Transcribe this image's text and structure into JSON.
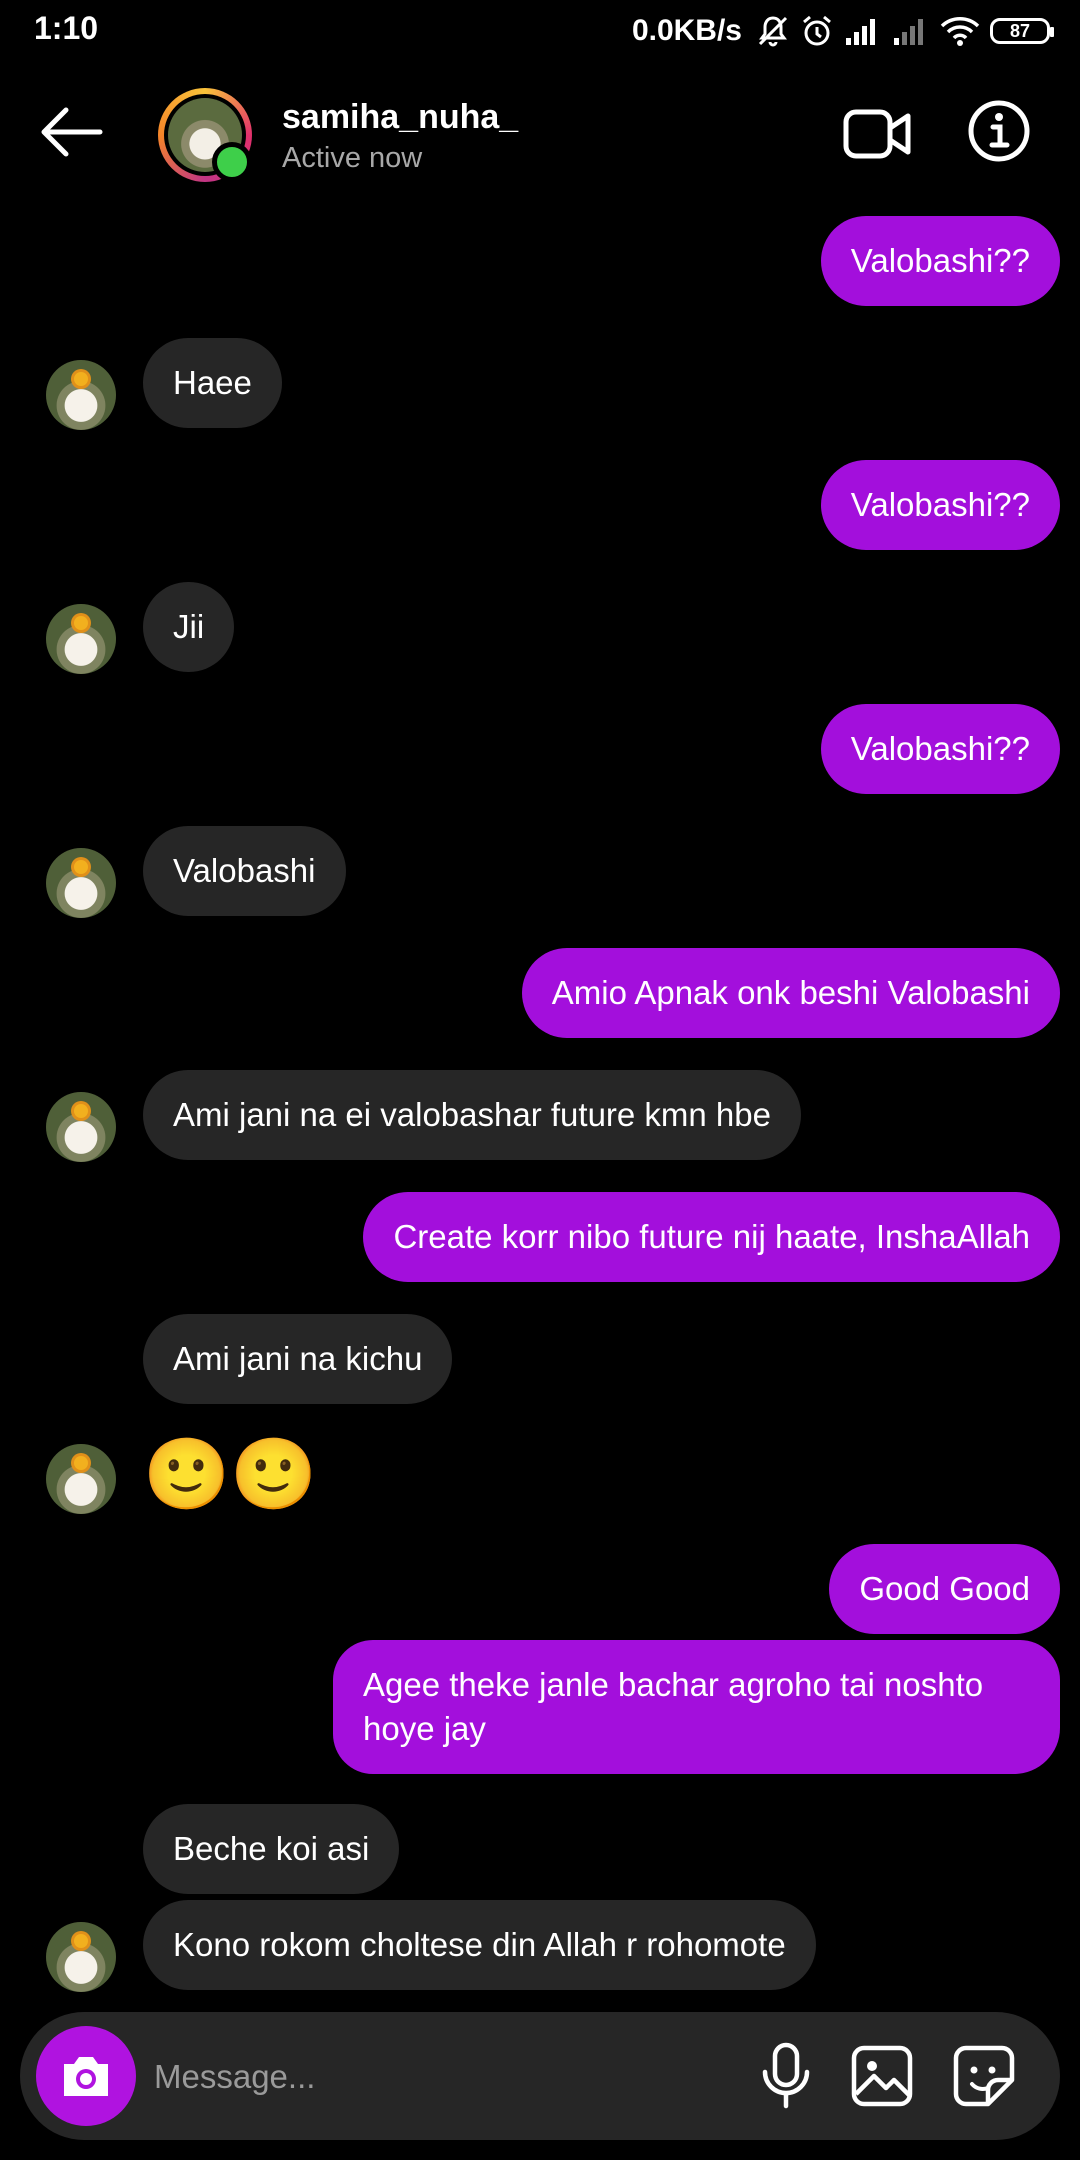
{
  "status_bar": {
    "time": "1:10",
    "network_speed": "0.0KB/s",
    "battery": "87",
    "icons": [
      "mute-icon",
      "alarm-icon",
      "signal-icon",
      "signal-weak-icon",
      "wifi-icon",
      "battery-icon"
    ]
  },
  "header": {
    "username": "samiha_nuha_",
    "status": "Active now",
    "icons": [
      "back-arrow-icon",
      "video-call-icon",
      "info-icon"
    ]
  },
  "messages": [
    {
      "direction": "out",
      "text": "Valobashi??"
    },
    {
      "direction": "in",
      "text": "Haee"
    },
    {
      "direction": "out",
      "text": "Valobashi??"
    },
    {
      "direction": "in",
      "text": "Jii"
    },
    {
      "direction": "out",
      "text": "Valobashi??"
    },
    {
      "direction": "in",
      "text": "Valobashi"
    },
    {
      "direction": "out",
      "text": "Amio Apnak onk beshi Valobashi"
    },
    {
      "direction": "in",
      "text": "Ami jani na ei valobashar future kmn hbe"
    },
    {
      "direction": "out",
      "text": "Create korr nibo future nij haate, InshaAllah"
    },
    {
      "direction": "in",
      "text": "Ami jani na kichu"
    },
    {
      "direction": "in",
      "text": "🙂🙂"
    },
    {
      "direction": "out",
      "text": "Good Good"
    },
    {
      "direction": "out",
      "text": "Agee theke janle bachar agroho tai noshto hoye jay"
    },
    {
      "direction": "in",
      "text": "Beche koi asi"
    },
    {
      "direction": "in",
      "text": "Kono rokom choltese din Allah r rohomote"
    }
  ],
  "composer": {
    "placeholder": "Message...",
    "icons": [
      "camera-icon",
      "microphone-icon",
      "gallery-icon",
      "sticker-icon"
    ]
  },
  "colors": {
    "outgoing_bubble": "#a30fdc",
    "incoming_bubble": "#262626",
    "camera_button": "#b013e0",
    "online_dot": "#3ecf4a",
    "background": "#000000"
  }
}
